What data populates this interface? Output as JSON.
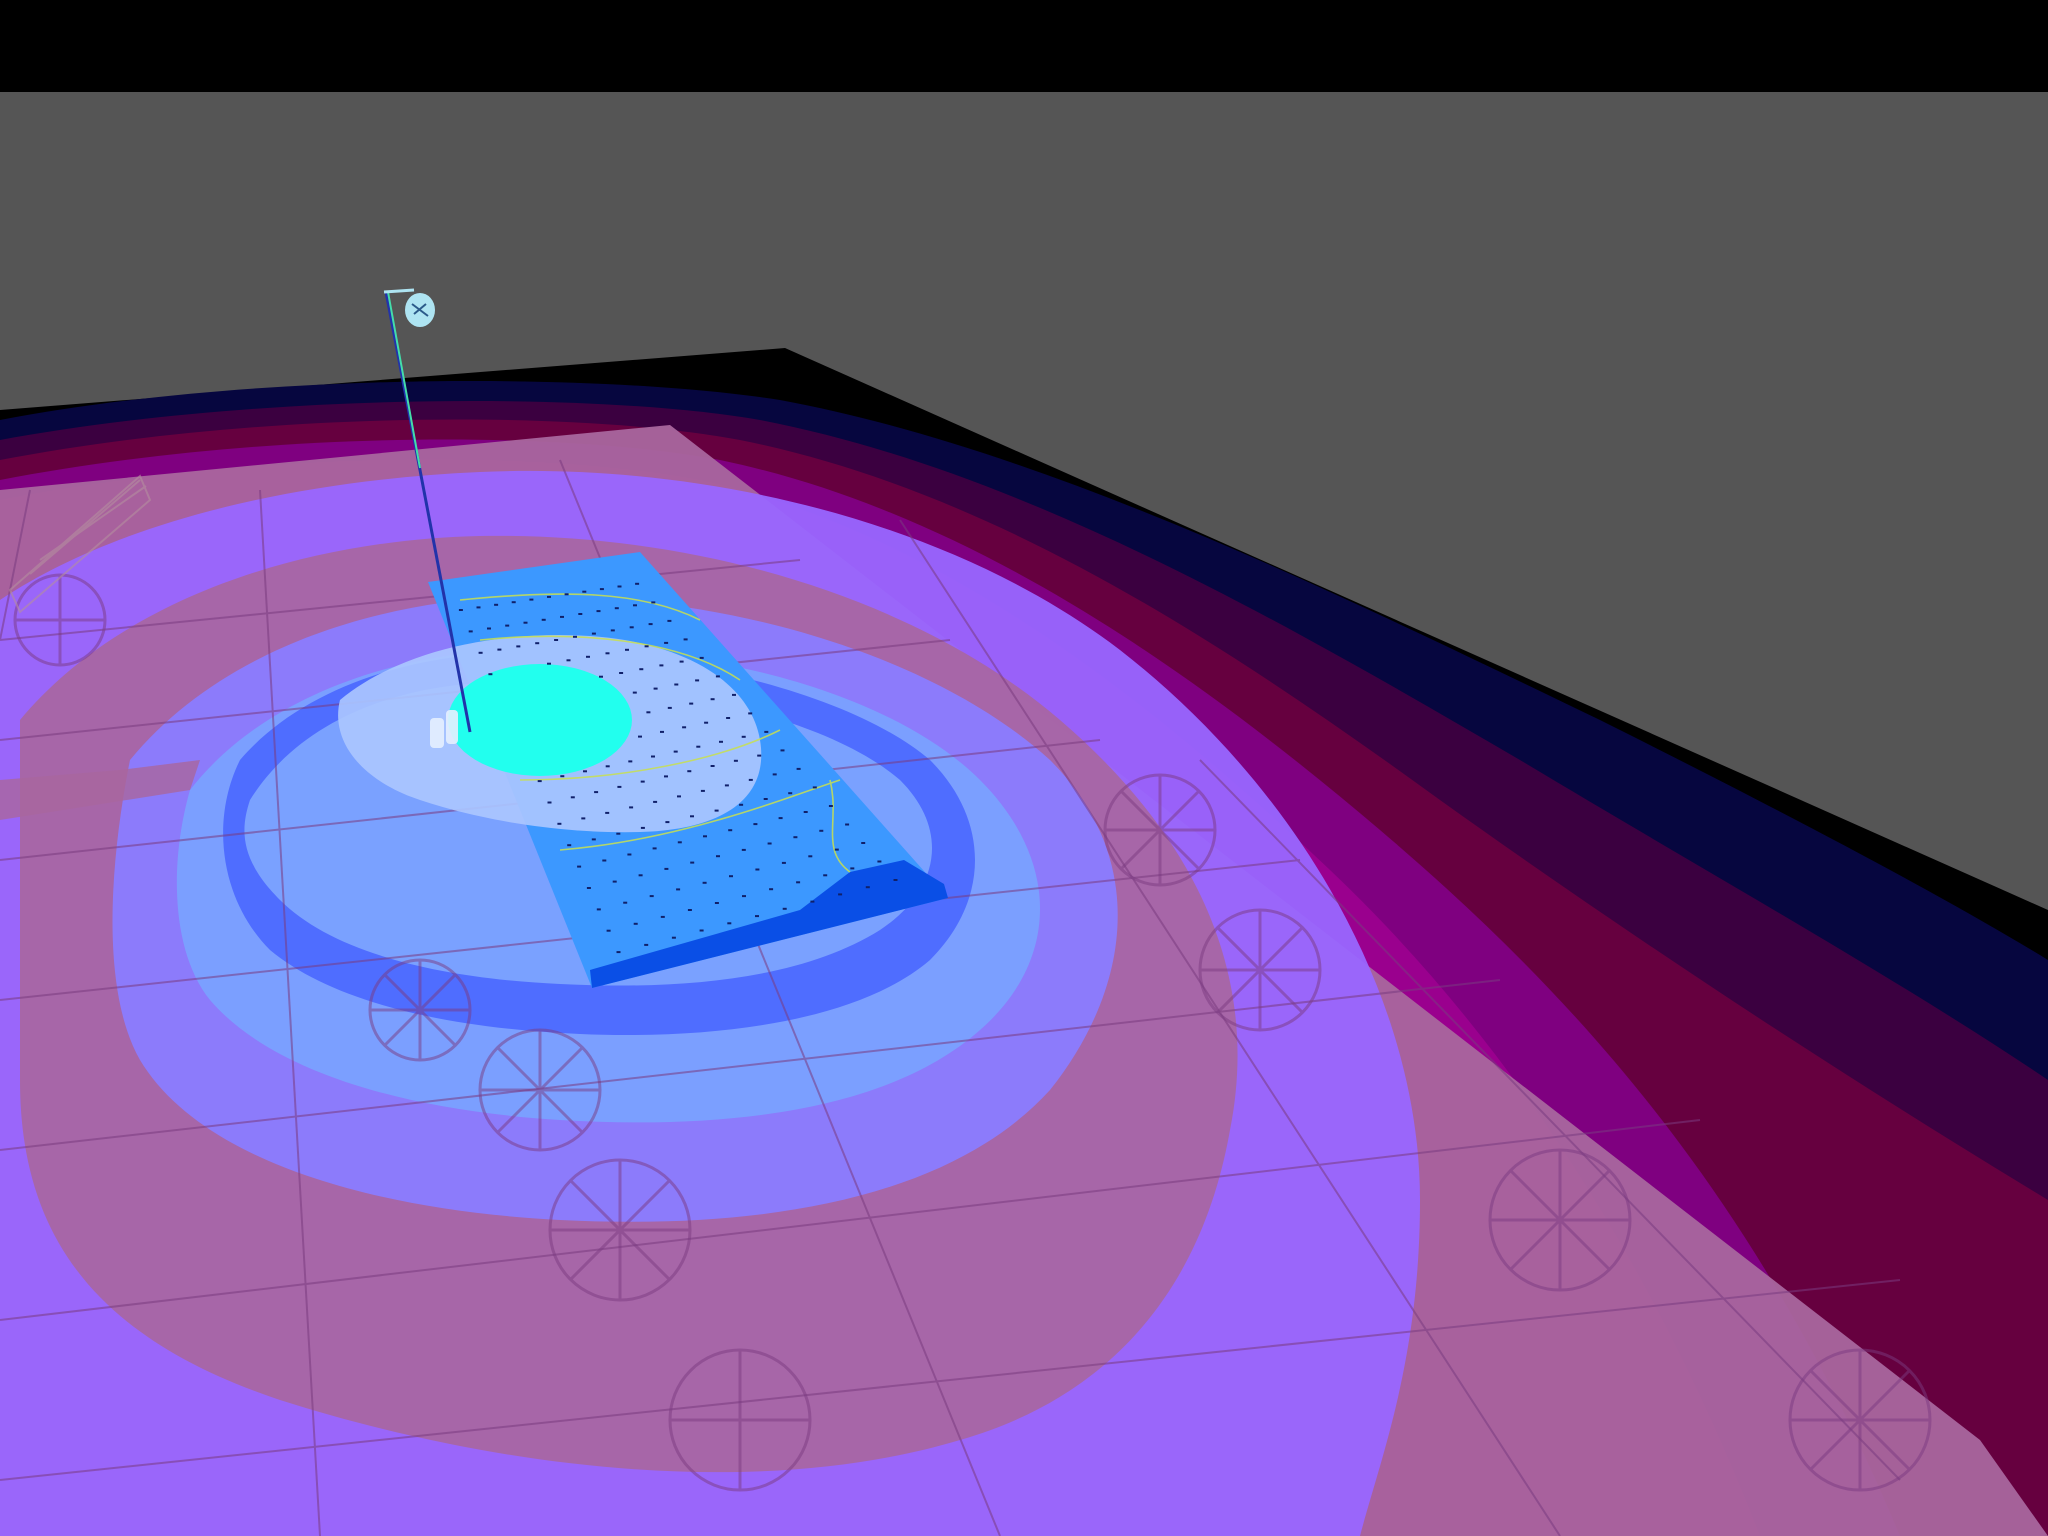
{
  "scene": {
    "kind": "3D lighting isocontour view",
    "background_color": "#555555",
    "top_bar_color": "#000000",
    "ground_color": "#000000",
    "contour_palette": [
      "#000000",
      "#06063f",
      "#3b0040",
      "#66003f",
      "#7f0080",
      "#9a008e",
      "#a9669e",
      "#9966ff",
      "#8a7cff",
      "#7aa1ff",
      "#4f6dff",
      "#3b8cff",
      "#aac6ff",
      "#22ffee"
    ],
    "panel_color": "#3c98ff",
    "panel_dark_edge": "#0a4fe6",
    "luminaire_color": "#aee4f2",
    "plan_line_color": "#7a3b80"
  }
}
